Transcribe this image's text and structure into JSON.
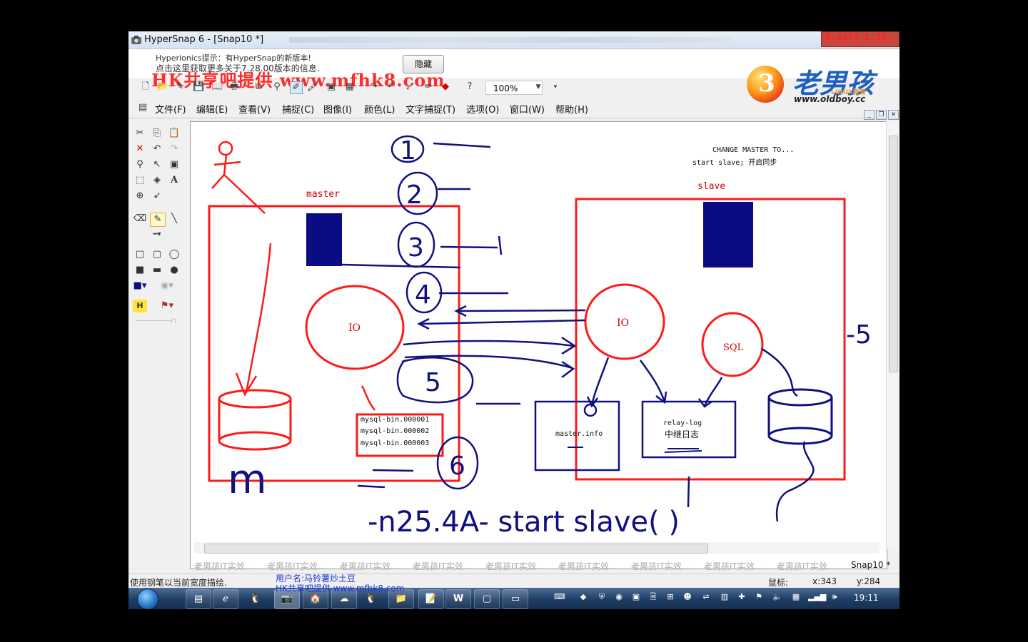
{
  "window": {
    "title": "HyperSnap 6 - [Snap10 *]",
    "time_overlay": "4:3171 1:58"
  },
  "notice": {
    "line1": "Hyperionics提示：有HyperSnap的新版本!",
    "line2": "点击这里获取更多关于7.28.00版本的信息.",
    "hide_label": "隐藏",
    "watermark": "HK共享吧提供 www.mfhk8.com"
  },
  "logo": {
    "mark": "3",
    "title": "老男孩",
    "subtitle": "LINUX教育",
    "url": "www.oldboy.cc"
  },
  "toolbar": {
    "zoom": "100%"
  },
  "menu": [
    "文件(F)",
    "编辑(E)",
    "查看(V)",
    "捕捉(C)",
    "图像(I)",
    "颜色(L)",
    "文字捕捉(T)",
    "选项(O)",
    "窗口(W)",
    "帮助(H)"
  ],
  "canvas": {
    "note1": "CHANGE MASTER TO...",
    "note2": "start slave; 开启同步",
    "master_label": "master",
    "slave_label": "slave",
    "master_io": "IO",
    "slave_io": "IO",
    "slave_sql": "SQL",
    "binlogs": [
      "mysql-bin.000001",
      "mysql-bin.000002",
      "mysql-bin.000003"
    ],
    "master_info": "master.info",
    "relay_log": "relay-log",
    "relay_log_cn": "中继日志",
    "hand_steps": [
      "1",
      "2",
      "3",
      "4",
      "5",
      "6"
    ],
    "hand_m": "m",
    "hand_side": "-5",
    "hand_text": "-n25.4A- start slave(   )"
  },
  "tabs": [
    "老男孩IT实效...",
    "老男孩IT实效...",
    "老男孩IT实效...",
    "老男孩IT实效...",
    "老男孩IT实效...",
    "老男孩IT实效...",
    "老男孩IT实效...",
    "老男孩IT实效...",
    "老男孩IT实效...",
    "Snap10 *"
  ],
  "status": {
    "left": "使用钢笔以当前宽度描绘.",
    "user": "用户名:马铃薯炒土豆",
    "hk": "HK共享吧提供 www.mfhk8.com",
    "mouse_label": "鼠标:",
    "x": "x:343",
    "y": "y:284"
  },
  "taskbar": {
    "clock": "19:11"
  },
  "colors": {
    "red_ink": "#ff1a1a",
    "blue_ink": "#101080",
    "navy_block": "#0b0b84",
    "taskbar": "#1f3c63"
  }
}
